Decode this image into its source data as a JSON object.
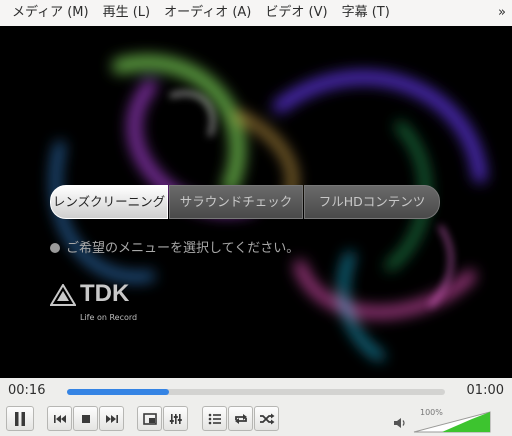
{
  "menubar": {
    "items": [
      "メディア (M)",
      "再生 (L)",
      "オーディオ (A)",
      "ビデオ (V)",
      "字幕 (T)"
    ],
    "overflow": "»"
  },
  "video": {
    "tabs": [
      "レンズクリーニング",
      "サラウンドチェック",
      "フルHDコンテンツ"
    ],
    "prompt": "ご希望のメニューを選択してください。",
    "logo_text": "TDK",
    "logo_tagline": "Life on Record"
  },
  "seek": {
    "current_time": "00:16",
    "total_time": "01:00",
    "progress_fraction": 0.27
  },
  "controls": {
    "buttons": [
      "pause-icon",
      "previous-icon",
      "stop-icon",
      "next-icon",
      "fullscreen-icon",
      "equalizer-icon",
      "playlist-icon",
      "loop-icon",
      "shuffle-icon"
    ]
  },
  "volume": {
    "label": "100%",
    "level_fraction": 1.0
  }
}
